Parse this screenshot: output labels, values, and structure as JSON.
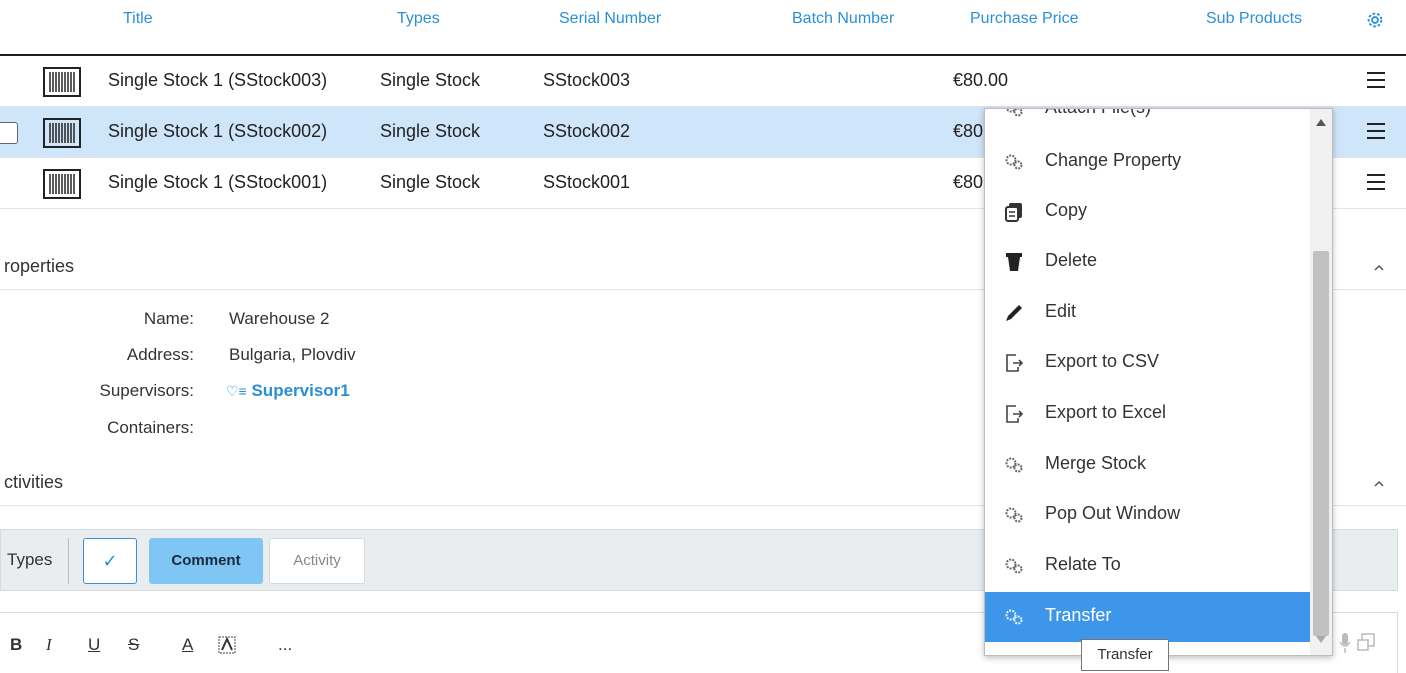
{
  "table": {
    "columns": [
      "Title",
      "Types",
      "Serial Number",
      "Batch Number",
      "Purchase Price",
      "Sub Products"
    ],
    "rows": [
      {
        "title": "Single Stock 1 (SStock003)",
        "type": "Single Stock",
        "serial": "SStock003",
        "price": "€80.00"
      },
      {
        "title": "Single Stock 1 (SStock002)",
        "type": "Single Stock",
        "serial": "SStock002",
        "price": "€80"
      },
      {
        "title": "Single Stock 1 (SStock001)",
        "type": "Single Stock",
        "serial": "SStock001",
        "price": "€80"
      }
    ]
  },
  "properties": {
    "title": "roperties",
    "name_label": "Name:",
    "name_value": "Warehouse 2",
    "address_label": "Address:",
    "address_value": "Bulgaria, Plovdiv",
    "supervisors_label": "Supervisors:",
    "supervisor": "Supervisor1",
    "containers_label": "Containers:"
  },
  "activities": {
    "title": "ctivities",
    "types_label": "Types",
    "check": "✓",
    "comment": "Comment",
    "activity": "Activity"
  },
  "editor": {
    "bold": "B",
    "italic": "I",
    "underline": "U",
    "strike": "S",
    "font_color": "A",
    "more": "..."
  },
  "dropdown": {
    "items": [
      {
        "label": "Attach File(s)",
        "icon": "gears-icon"
      },
      {
        "label": "Change Property",
        "icon": "gears-icon"
      },
      {
        "label": "Copy",
        "icon": "copy-icon"
      },
      {
        "label": "Delete",
        "icon": "trash-icon"
      },
      {
        "label": "Edit",
        "icon": "pencil-icon"
      },
      {
        "label": "Export to CSV",
        "icon": "export-icon"
      },
      {
        "label": "Export to Excel",
        "icon": "export-icon"
      },
      {
        "label": "Merge Stock",
        "icon": "gears-icon"
      },
      {
        "label": "Pop Out Window",
        "icon": "gears-icon"
      },
      {
        "label": "Relate To",
        "icon": "gears-icon"
      },
      {
        "label": "Transfer",
        "icon": "gears-icon"
      }
    ],
    "highlighted": "Transfer"
  },
  "tooltip": "Transfer",
  "colors": {
    "accent": "#2a8fd8",
    "row_selected": "#cfe5fa",
    "menu_highlight": "#3d96ea",
    "comment_button": "#7fc6f5"
  }
}
